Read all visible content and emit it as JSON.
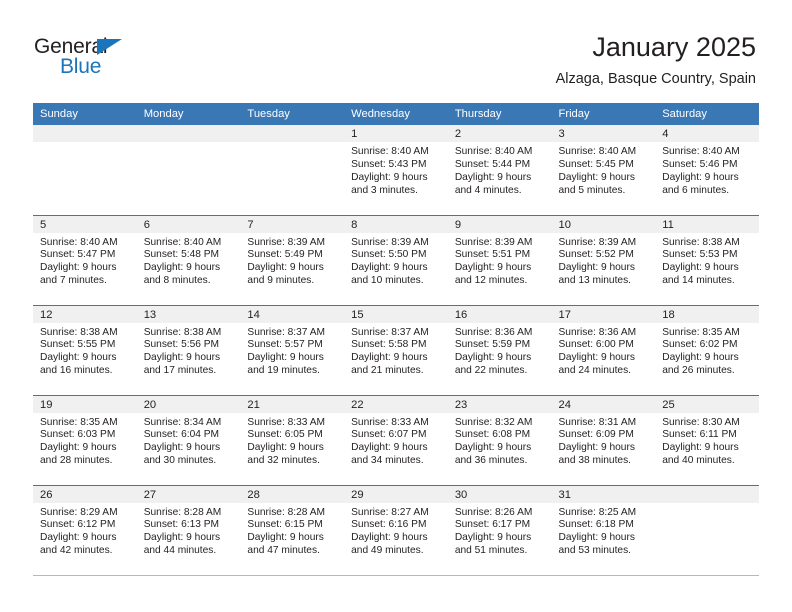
{
  "brand": {
    "line1": "General",
    "line2": "Blue",
    "accent_color": "#1b75bb",
    "logo_icon": "triangle-logo-icon"
  },
  "header": {
    "title": "January 2025",
    "subtitle": "Alzaga, Basque Country, Spain"
  },
  "theme": {
    "header_blue": "#3a77b5",
    "daynum_band": "#f0f0f0",
    "text": "#231f20"
  },
  "columns": [
    "Sunday",
    "Monday",
    "Tuesday",
    "Wednesday",
    "Thursday",
    "Friday",
    "Saturday"
  ],
  "weeks": [
    [
      {
        "day": "",
        "lines": []
      },
      {
        "day": "",
        "lines": []
      },
      {
        "day": "",
        "lines": []
      },
      {
        "day": "1",
        "lines": [
          "Sunrise: 8:40 AM",
          "Sunset: 5:43 PM",
          "Daylight: 9 hours",
          "and 3 minutes."
        ]
      },
      {
        "day": "2",
        "lines": [
          "Sunrise: 8:40 AM",
          "Sunset: 5:44 PM",
          "Daylight: 9 hours",
          "and 4 minutes."
        ]
      },
      {
        "day": "3",
        "lines": [
          "Sunrise: 8:40 AM",
          "Sunset: 5:45 PM",
          "Daylight: 9 hours",
          "and 5 minutes."
        ]
      },
      {
        "day": "4",
        "lines": [
          "Sunrise: 8:40 AM",
          "Sunset: 5:46 PM",
          "Daylight: 9 hours",
          "and 6 minutes."
        ]
      }
    ],
    [
      {
        "day": "5",
        "lines": [
          "Sunrise: 8:40 AM",
          "Sunset: 5:47 PM",
          "Daylight: 9 hours",
          "and 7 minutes."
        ]
      },
      {
        "day": "6",
        "lines": [
          "Sunrise: 8:40 AM",
          "Sunset: 5:48 PM",
          "Daylight: 9 hours",
          "and 8 minutes."
        ]
      },
      {
        "day": "7",
        "lines": [
          "Sunrise: 8:39 AM",
          "Sunset: 5:49 PM",
          "Daylight: 9 hours",
          "and 9 minutes."
        ]
      },
      {
        "day": "8",
        "lines": [
          "Sunrise: 8:39 AM",
          "Sunset: 5:50 PM",
          "Daylight: 9 hours",
          "and 10 minutes."
        ]
      },
      {
        "day": "9",
        "lines": [
          "Sunrise: 8:39 AM",
          "Sunset: 5:51 PM",
          "Daylight: 9 hours",
          "and 12 minutes."
        ]
      },
      {
        "day": "10",
        "lines": [
          "Sunrise: 8:39 AM",
          "Sunset: 5:52 PM",
          "Daylight: 9 hours",
          "and 13 minutes."
        ]
      },
      {
        "day": "11",
        "lines": [
          "Sunrise: 8:38 AM",
          "Sunset: 5:53 PM",
          "Daylight: 9 hours",
          "and 14 minutes."
        ]
      }
    ],
    [
      {
        "day": "12",
        "lines": [
          "Sunrise: 8:38 AM",
          "Sunset: 5:55 PM",
          "Daylight: 9 hours",
          "and 16 minutes."
        ]
      },
      {
        "day": "13",
        "lines": [
          "Sunrise: 8:38 AM",
          "Sunset: 5:56 PM",
          "Daylight: 9 hours",
          "and 17 minutes."
        ]
      },
      {
        "day": "14",
        "lines": [
          "Sunrise: 8:37 AM",
          "Sunset: 5:57 PM",
          "Daylight: 9 hours",
          "and 19 minutes."
        ]
      },
      {
        "day": "15",
        "lines": [
          "Sunrise: 8:37 AM",
          "Sunset: 5:58 PM",
          "Daylight: 9 hours",
          "and 21 minutes."
        ]
      },
      {
        "day": "16",
        "lines": [
          "Sunrise: 8:36 AM",
          "Sunset: 5:59 PM",
          "Daylight: 9 hours",
          "and 22 minutes."
        ]
      },
      {
        "day": "17",
        "lines": [
          "Sunrise: 8:36 AM",
          "Sunset: 6:00 PM",
          "Daylight: 9 hours",
          "and 24 minutes."
        ]
      },
      {
        "day": "18",
        "lines": [
          "Sunrise: 8:35 AM",
          "Sunset: 6:02 PM",
          "Daylight: 9 hours",
          "and 26 minutes."
        ]
      }
    ],
    [
      {
        "day": "19",
        "lines": [
          "Sunrise: 8:35 AM",
          "Sunset: 6:03 PM",
          "Daylight: 9 hours",
          "and 28 minutes."
        ]
      },
      {
        "day": "20",
        "lines": [
          "Sunrise: 8:34 AM",
          "Sunset: 6:04 PM",
          "Daylight: 9 hours",
          "and 30 minutes."
        ]
      },
      {
        "day": "21",
        "lines": [
          "Sunrise: 8:33 AM",
          "Sunset: 6:05 PM",
          "Daylight: 9 hours",
          "and 32 minutes."
        ]
      },
      {
        "day": "22",
        "lines": [
          "Sunrise: 8:33 AM",
          "Sunset: 6:07 PM",
          "Daylight: 9 hours",
          "and 34 minutes."
        ]
      },
      {
        "day": "23",
        "lines": [
          "Sunrise: 8:32 AM",
          "Sunset: 6:08 PM",
          "Daylight: 9 hours",
          "and 36 minutes."
        ]
      },
      {
        "day": "24",
        "lines": [
          "Sunrise: 8:31 AM",
          "Sunset: 6:09 PM",
          "Daylight: 9 hours",
          "and 38 minutes."
        ]
      },
      {
        "day": "25",
        "lines": [
          "Sunrise: 8:30 AM",
          "Sunset: 6:11 PM",
          "Daylight: 9 hours",
          "and 40 minutes."
        ]
      }
    ],
    [
      {
        "day": "26",
        "lines": [
          "Sunrise: 8:29 AM",
          "Sunset: 6:12 PM",
          "Daylight: 9 hours",
          "and 42 minutes."
        ]
      },
      {
        "day": "27",
        "lines": [
          "Sunrise: 8:28 AM",
          "Sunset: 6:13 PM",
          "Daylight: 9 hours",
          "and 44 minutes."
        ]
      },
      {
        "day": "28",
        "lines": [
          "Sunrise: 8:28 AM",
          "Sunset: 6:15 PM",
          "Daylight: 9 hours",
          "and 47 minutes."
        ]
      },
      {
        "day": "29",
        "lines": [
          "Sunrise: 8:27 AM",
          "Sunset: 6:16 PM",
          "Daylight: 9 hours",
          "and 49 minutes."
        ]
      },
      {
        "day": "30",
        "lines": [
          "Sunrise: 8:26 AM",
          "Sunset: 6:17 PM",
          "Daylight: 9 hours",
          "and 51 minutes."
        ]
      },
      {
        "day": "31",
        "lines": [
          "Sunrise: 8:25 AM",
          "Sunset: 6:18 PM",
          "Daylight: 9 hours",
          "and 53 minutes."
        ]
      },
      {
        "day": "",
        "lines": []
      }
    ]
  ]
}
